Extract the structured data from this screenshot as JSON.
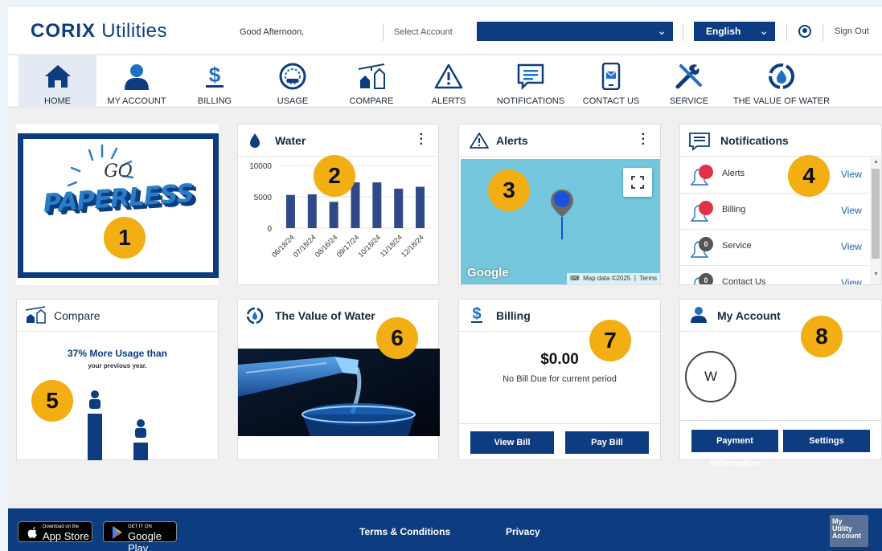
{
  "header": {
    "logo_brand": "CORIX",
    "logo_suffix": "Utilities",
    "greeting": "Good Afternoon,",
    "select_account_label": "Select Account",
    "account_value": "",
    "language": "English",
    "sign_out": "Sign Out"
  },
  "nav": [
    {
      "label": "HOME",
      "icon": "home-icon"
    },
    {
      "label": "MY ACCOUNT",
      "icon": "user-icon"
    },
    {
      "label": "BILLING",
      "icon": "dollar-icon"
    },
    {
      "label": "USAGE",
      "icon": "gauge-icon"
    },
    {
      "label": "COMPARE",
      "icon": "compare-houses-icon"
    },
    {
      "label": "ALERTS",
      "icon": "alert-triangle-icon"
    },
    {
      "label": "NOTIFICATIONS",
      "icon": "message-icon"
    },
    {
      "label": "CONTACT US",
      "icon": "phone-mail-icon"
    },
    {
      "label": "SERVICE",
      "icon": "tools-icon"
    },
    {
      "label": "THE VALUE OF WATER",
      "icon": "water-cycle-icon"
    }
  ],
  "cards": {
    "paperless": {
      "line1": "GO",
      "line2": "PAPERLESS",
      "badge": "1"
    },
    "water": {
      "title": "Water",
      "badge": "2",
      "chart_data": {
        "type": "bar",
        "categories": [
          "06/18/24",
          "07/18/24",
          "08/16/24",
          "09/17/24",
          "10/18/24",
          "11/18/24",
          "12/18/24"
        ],
        "values": [
          5300,
          5400,
          4200,
          7300,
          7300,
          6300,
          6600
        ],
        "yticks": [
          "10000",
          "5000",
          "0"
        ],
        "ylim": [
          0,
          10000
        ],
        "bar_color": "#2f4a86"
      }
    },
    "alerts": {
      "title": "Alerts",
      "badge": "3",
      "google": "Google",
      "map_data": "Map data ©2025",
      "terms": "Terms",
      "map_color": "#73c6dc"
    },
    "notifications": {
      "title": "Notifications",
      "badge": "4",
      "rows": [
        {
          "label": "Alerts",
          "action": "View",
          "count": ""
        },
        {
          "label": "Billing",
          "action": "View",
          "count": ""
        },
        {
          "label": "Service",
          "action": "View",
          "count": "0"
        },
        {
          "label": "Contact Us",
          "action": "View",
          "count": "0"
        }
      ]
    },
    "compare": {
      "title": "Compare",
      "headline": "37% More Usage than",
      "sub": "your previous year.",
      "badge": "5"
    },
    "value_of_water": {
      "title": "The Value of Water",
      "badge": "6"
    },
    "billing": {
      "title": "Billing",
      "amount": "$0.00",
      "status": "No Bill Due for current period",
      "view_bill": "View Bill",
      "pay_bill": "Pay Bill",
      "badge": "7"
    },
    "my_account": {
      "title": "My Account",
      "avatar_letter": "W",
      "payment_info": "Payment Information",
      "settings": "Settings",
      "badge": "8"
    }
  },
  "footer": {
    "app_store_small": "Download on the",
    "app_store": "App Store",
    "google_play_small": "GET IT ON",
    "google_play": "Google Play",
    "terms": "Terms & Conditions",
    "privacy": "Privacy",
    "badge_l1": "My",
    "badge_l2": "Utility",
    "badge_l3": "Account"
  },
  "colors": {
    "brand": "#0d3d80",
    "badge": "#f2ae13",
    "link": "#1f5fb0",
    "alert_red": "#e0334a"
  }
}
